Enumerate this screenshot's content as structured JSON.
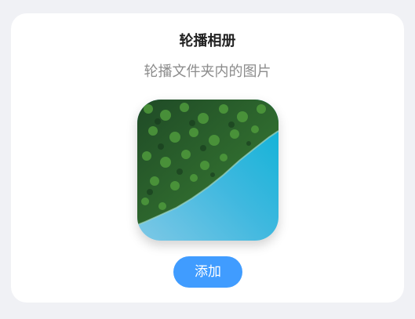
{
  "album": {
    "title": "轮播相册",
    "subtitle": "轮播文件夹内的图片",
    "image_icon": "aerial-forest-lake-image",
    "add_label": "添加"
  },
  "colors": {
    "background": "#f0f1f5",
    "card": "#ffffff",
    "accent": "#409cff",
    "title": "#222222",
    "subtitle": "#8c8c8c"
  }
}
